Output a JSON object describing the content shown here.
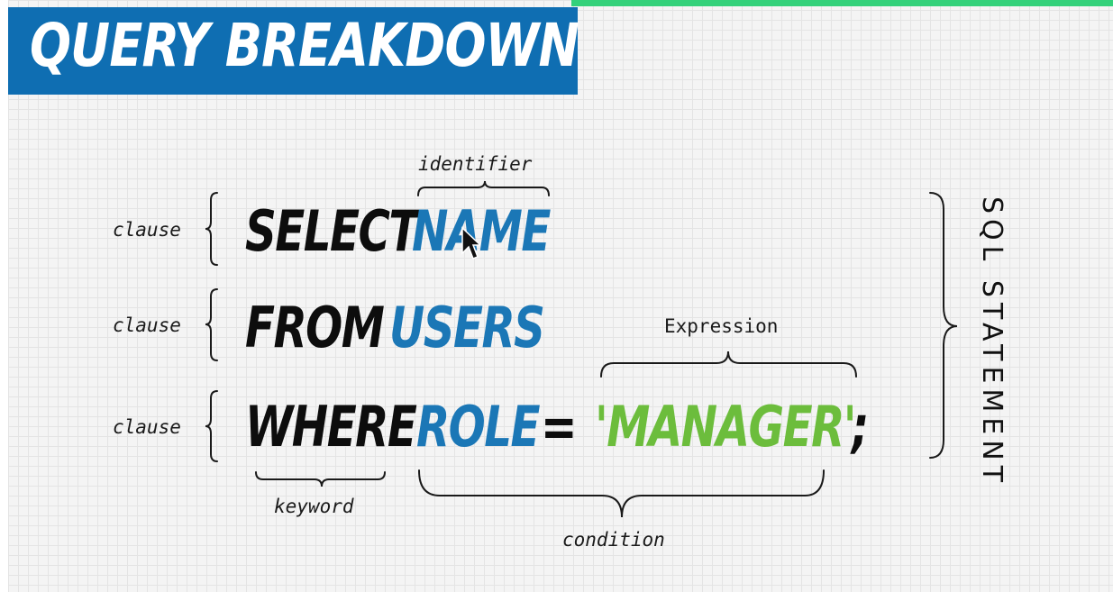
{
  "banner": {
    "title": "QUERY BREAKDOWN"
  },
  "labels": {
    "identifier": "identifier",
    "expression": "Expression",
    "keyword": "keyword",
    "condition": "condition",
    "clause_1": "clause",
    "clause_2": "clause",
    "clause_3": "clause",
    "statement": "SQL STATEMENT"
  },
  "query": {
    "line1": {
      "keyword": "SELECT",
      "identifier": "NAME"
    },
    "line2": {
      "keyword": "FROM",
      "identifier": "USERS"
    },
    "line3": {
      "keyword": "WHERE",
      "identifier": "ROLE",
      "operator": "=",
      "value": "'MANAGER'",
      "terminator": ";"
    }
  },
  "colors": {
    "banner_bg": "#0f6eb2",
    "keyword": "#0d0d0d",
    "identifier": "#1b77b6",
    "string_value": "#6cbd3c",
    "accent_bar": "#33d17a"
  },
  "icons": {
    "pointer": "mouse-cursor-icon"
  }
}
